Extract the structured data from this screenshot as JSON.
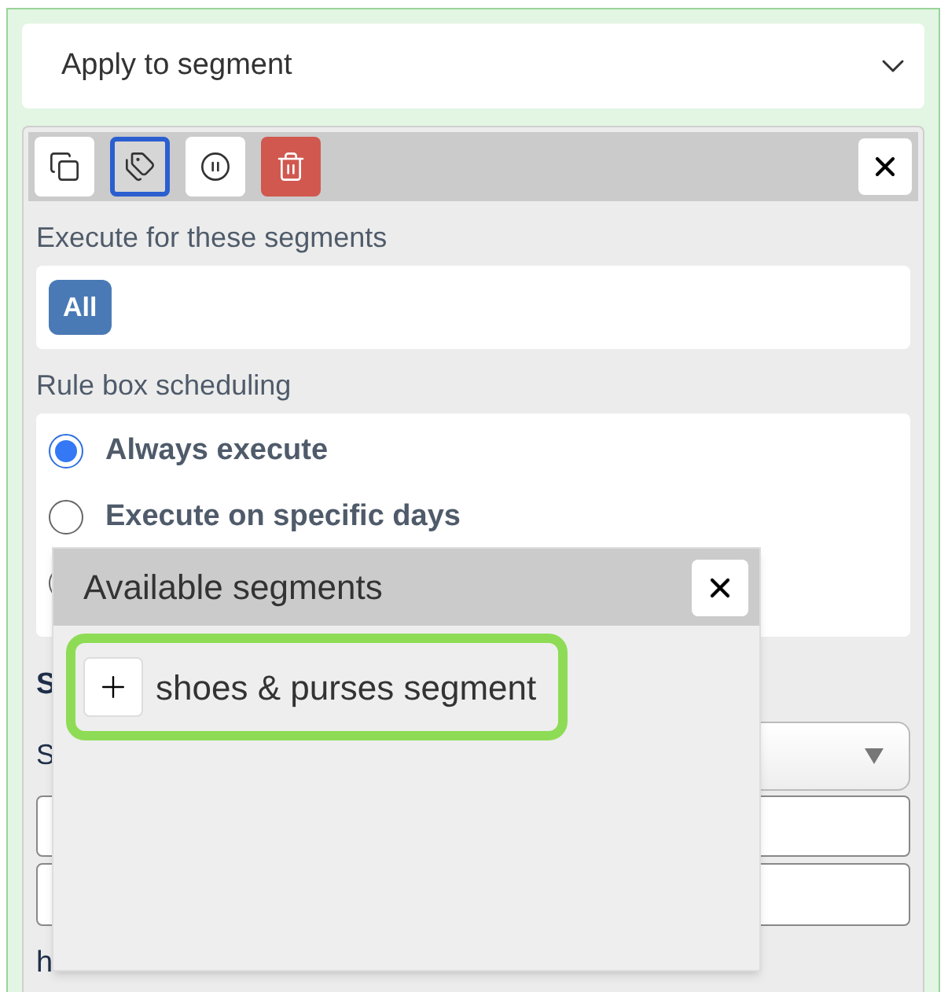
{
  "apply_dropdown": {
    "value": "Apply to segment"
  },
  "toolbar": {
    "buttons": [
      {
        "kind": "copy",
        "selected": false
      },
      {
        "kind": "tags",
        "selected": true
      },
      {
        "kind": "pause",
        "selected": false
      },
      {
        "kind": "delete",
        "selected": false
      }
    ]
  },
  "segments_section": {
    "label": "Execute for these segments",
    "badges": [
      "All"
    ]
  },
  "scheduling": {
    "label": "Rule box scheduling",
    "options": [
      {
        "label": "Always execute",
        "selected": true
      },
      {
        "label": "Execute on specific days",
        "selected": false
      },
      {
        "selected": false
      }
    ]
  },
  "hidden_section": {
    "heading": "S",
    "field_label": "S",
    "footer_text": "h"
  },
  "popup": {
    "title": "Available segments",
    "items": [
      "shoes & purses segment"
    ]
  }
}
